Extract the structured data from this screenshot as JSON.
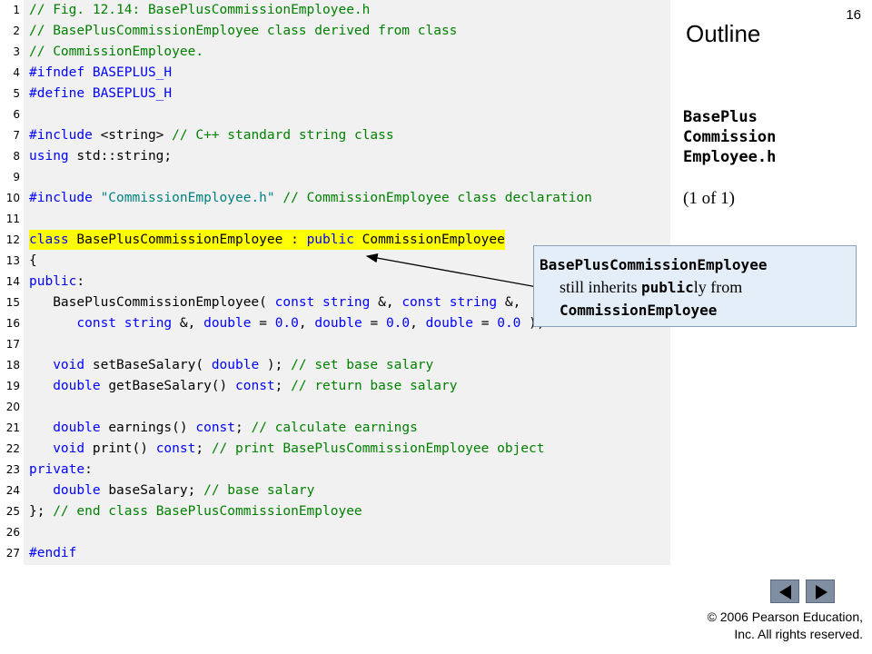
{
  "page_number": "16",
  "outline_title": "Outline",
  "side_title": [
    "BasePlus",
    "Commission",
    "Employee.h"
  ],
  "side_page": "(1 of 1)",
  "callout": {
    "line1": "BasePlusCommissionEmployee",
    "line2_pre": "still inherits ",
    "line2_code": "public",
    "line2_post": "ly from",
    "line3": "CommissionEmployee"
  },
  "footer": {
    "line1": "© 2006 Pearson Education,",
    "line2": "Inc.  All rights reserved."
  },
  "nav": {
    "prev_label": "previous",
    "next_label": "next"
  },
  "colors": {
    "keyword": "#0000ff",
    "comment": "#008000",
    "string": "#008080",
    "highlight": "#ffff00",
    "callout_bg": "#e4eef8",
    "nav_button": "#7f8ea0"
  },
  "code_lines": [
    {
      "n": "1",
      "segs": [
        [
          "cm",
          "// Fig. 12.14: BasePlusCommissionEmployee.h"
        ]
      ]
    },
    {
      "n": "2",
      "segs": [
        [
          "cm",
          "// BasePlusCommissionEmployee class derived from class"
        ]
      ]
    },
    {
      "n": "3",
      "segs": [
        [
          "cm",
          "// CommissionEmployee."
        ]
      ]
    },
    {
      "n": "4",
      "segs": [
        [
          "kw",
          "#ifndef"
        ],
        [
          "",
          " "
        ],
        [
          "kw",
          "BASEPLUS_H"
        ]
      ]
    },
    {
      "n": "5",
      "segs": [
        [
          "kw",
          "#define"
        ],
        [
          "",
          " "
        ],
        [
          "kw",
          "BASEPLUS_H"
        ]
      ]
    },
    {
      "n": "6",
      "segs": []
    },
    {
      "n": "7",
      "segs": [
        [
          "kw",
          "#include"
        ],
        [
          "",
          " <string> "
        ],
        [
          "cm",
          "// C++ standard string class"
        ]
      ]
    },
    {
      "n": "8",
      "segs": [
        [
          "kw",
          "using"
        ],
        [
          "",
          " std::string;"
        ]
      ]
    },
    {
      "n": "9",
      "segs": []
    },
    {
      "n": "10",
      "segs": [
        [
          "kw",
          "#include"
        ],
        [
          "",
          " "
        ],
        [
          "st",
          "\"CommissionEmployee.h\""
        ],
        [
          "",
          " "
        ],
        [
          "cm",
          "// CommissionEmployee class declaration"
        ]
      ]
    },
    {
      "n": "11",
      "segs": []
    },
    {
      "n": "12",
      "hl": true,
      "segs": [
        [
          "kw",
          "class"
        ],
        [
          "",
          " BasePlusCommissionEmployee : "
        ],
        [
          "kw",
          "public"
        ],
        [
          "",
          " CommissionEmployee"
        ]
      ]
    },
    {
      "n": "13",
      "segs": [
        [
          "",
          "{"
        ]
      ]
    },
    {
      "n": "14",
      "segs": [
        [
          "kw",
          "public"
        ],
        [
          "",
          ":"
        ]
      ]
    },
    {
      "n": "15",
      "segs": [
        [
          "",
          "   BasePlusCommissionEmployee( "
        ],
        [
          "kw",
          "const"
        ],
        [
          "",
          " "
        ],
        [
          "kw",
          "string"
        ],
        [
          "",
          " &, "
        ],
        [
          "kw",
          "const"
        ],
        [
          "",
          " "
        ],
        [
          "kw",
          "string"
        ],
        [
          "",
          " &,"
        ]
      ]
    },
    {
      "n": "16",
      "segs": [
        [
          "",
          "      "
        ],
        [
          "kw",
          "const"
        ],
        [
          "",
          " "
        ],
        [
          "kw",
          "string"
        ],
        [
          "",
          " &, "
        ],
        [
          "kw",
          "double"
        ],
        [
          "",
          " = "
        ],
        [
          "kw",
          "0.0"
        ],
        [
          "",
          ", "
        ],
        [
          "kw",
          "double"
        ],
        [
          "",
          " = "
        ],
        [
          "kw",
          "0.0"
        ],
        [
          "",
          ", "
        ],
        [
          "kw",
          "double"
        ],
        [
          "",
          " = "
        ],
        [
          "kw",
          "0.0"
        ],
        [
          "",
          " );"
        ]
      ]
    },
    {
      "n": "17",
      "segs": []
    },
    {
      "n": "18",
      "segs": [
        [
          "",
          "   "
        ],
        [
          "kw",
          "void"
        ],
        [
          "",
          " setBaseSalary( "
        ],
        [
          "kw",
          "double"
        ],
        [
          "",
          " ); "
        ],
        [
          "cm",
          "// set base salary"
        ]
      ]
    },
    {
      "n": "19",
      "segs": [
        [
          "",
          "   "
        ],
        [
          "kw",
          "double"
        ],
        [
          "",
          " getBaseSalary() "
        ],
        [
          "kw",
          "const"
        ],
        [
          "",
          "; "
        ],
        [
          "cm",
          "// return base salary"
        ]
      ]
    },
    {
      "n": "20",
      "segs": []
    },
    {
      "n": "21",
      "segs": [
        [
          "",
          "   "
        ],
        [
          "kw",
          "double"
        ],
        [
          "",
          " earnings() "
        ],
        [
          "kw",
          "const"
        ],
        [
          "",
          "; "
        ],
        [
          "cm",
          "// calculate earnings"
        ]
      ]
    },
    {
      "n": "22",
      "segs": [
        [
          "",
          "   "
        ],
        [
          "kw",
          "void"
        ],
        [
          "",
          " print() "
        ],
        [
          "kw",
          "const"
        ],
        [
          "",
          "; "
        ],
        [
          "cm",
          "// print BasePlusCommissionEmployee object"
        ]
      ]
    },
    {
      "n": "23",
      "segs": [
        [
          "kw",
          "private"
        ],
        [
          "",
          ":"
        ]
      ]
    },
    {
      "n": "24",
      "segs": [
        [
          "",
          "   "
        ],
        [
          "kw",
          "double"
        ],
        [
          "",
          " baseSalary; "
        ],
        [
          "cm",
          "// base salary"
        ]
      ]
    },
    {
      "n": "25",
      "segs": [
        [
          "",
          "}; "
        ],
        [
          "cm",
          "// end class BasePlusCommissionEmployee"
        ]
      ]
    },
    {
      "n": "26",
      "segs": []
    },
    {
      "n": "27",
      "segs": [
        [
          "kw",
          "#endif"
        ]
      ]
    }
  ]
}
